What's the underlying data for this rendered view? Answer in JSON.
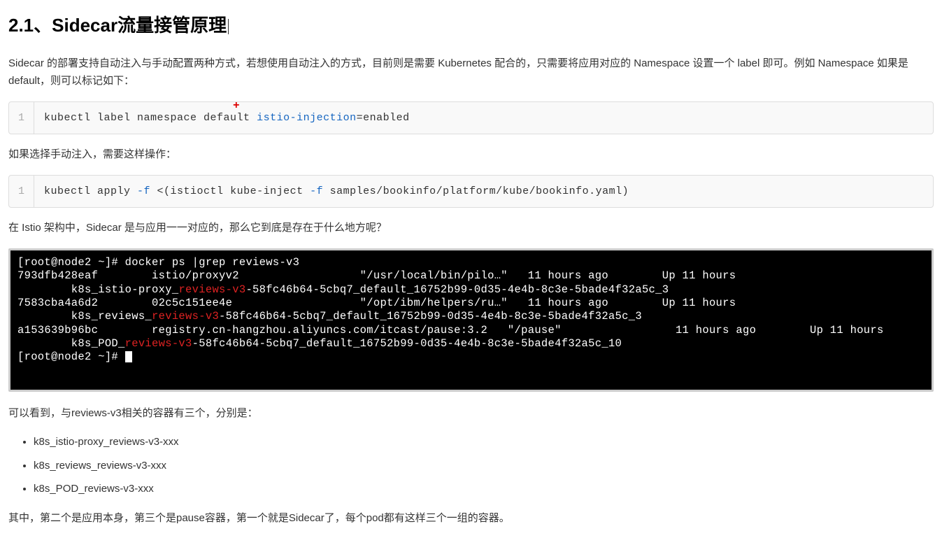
{
  "heading": "2.1、Sidecar流量接管原理",
  "paragraphs": {
    "p1": "Sidecar 的部署支持自动注入与手动配置两种方式，若想使用自动注入的方式，目前则是需要 Kubernetes 配合的，只需要将应用对应的 Namespace 设置一个 label 即可。例如 Namespace 如果是 default，则可以标记如下：",
    "p2": "如果选择手动注入，需要这样操作：",
    "p3": "在 Istio 架构中，Sidecar 是与应用一一对应的，那么它到底是存在于什么地方呢？",
    "p4": "可以看到，与reviews-v3相关的容器有三个，分别是：",
    "p5": "其中，第二个是应用本身，第三个是pause容器，第一个就是Sidecar了，每个pod都有这样三个一组的容器。"
  },
  "code1": {
    "lineno": "1",
    "t1": "kubectl label namespace defau",
    "t2": "lt ",
    "t3": "istio-injection",
    "t4": "=enabled",
    "cross": "+"
  },
  "code2": {
    "lineno": "1",
    "t1": "kubectl apply ",
    "t2": "-f",
    "t3": " <(istioctl kube-inject ",
    "t4": "-f",
    "t5": " samples/bookinfo/platform/kube/bookinfo.yaml)"
  },
  "terminal": {
    "l0a": "[root@node2 ~]# ",
    "l0b": "docker ps |grep reviews-v3",
    "l1": "793dfb428eaf        istio/proxyv2                  \"/usr/local/bin/pilo…\"   11 hours ago        Up 11 hours",
    "l2a": "        k8s_istio-proxy_",
    "l2b": "reviews-v3",
    "l2c": "-58fc46b64-5cbq7_default_16752b99-0d35-4e4b-8c3e-5bade4f32a5c_3",
    "l3": "7583cba4a6d2        02c5c151ee4e                   \"/opt/ibm/helpers/ru…\"   11 hours ago        Up 11 hours",
    "l4a": "        k8s_reviews_",
    "l4b": "reviews-v3",
    "l4c": "-58fc46b64-5cbq7_default_16752b99-0d35-4e4b-8c3e-5bade4f32a5c_3",
    "l5": "a153639b96bc        registry.cn-hangzhou.aliyuncs.com/itcast/pause:3.2   \"/pause\"                 11 hours ago        Up 11 hours",
    "l6a": "        k8s_POD_",
    "l6b": "reviews-v3",
    "l6c": "-58fc46b64-5cbq7_default_16752b99-0d35-4e4b-8c3e-5bade4f32a5c_10",
    "l7": "[root@node2 ~]# "
  },
  "list": {
    "i1": "k8s_istio-proxy_reviews-v3-xxx",
    "i2": "k8s_reviews_reviews-v3-xxx",
    "i3": "k8s_POD_reviews-v3-xxx"
  }
}
